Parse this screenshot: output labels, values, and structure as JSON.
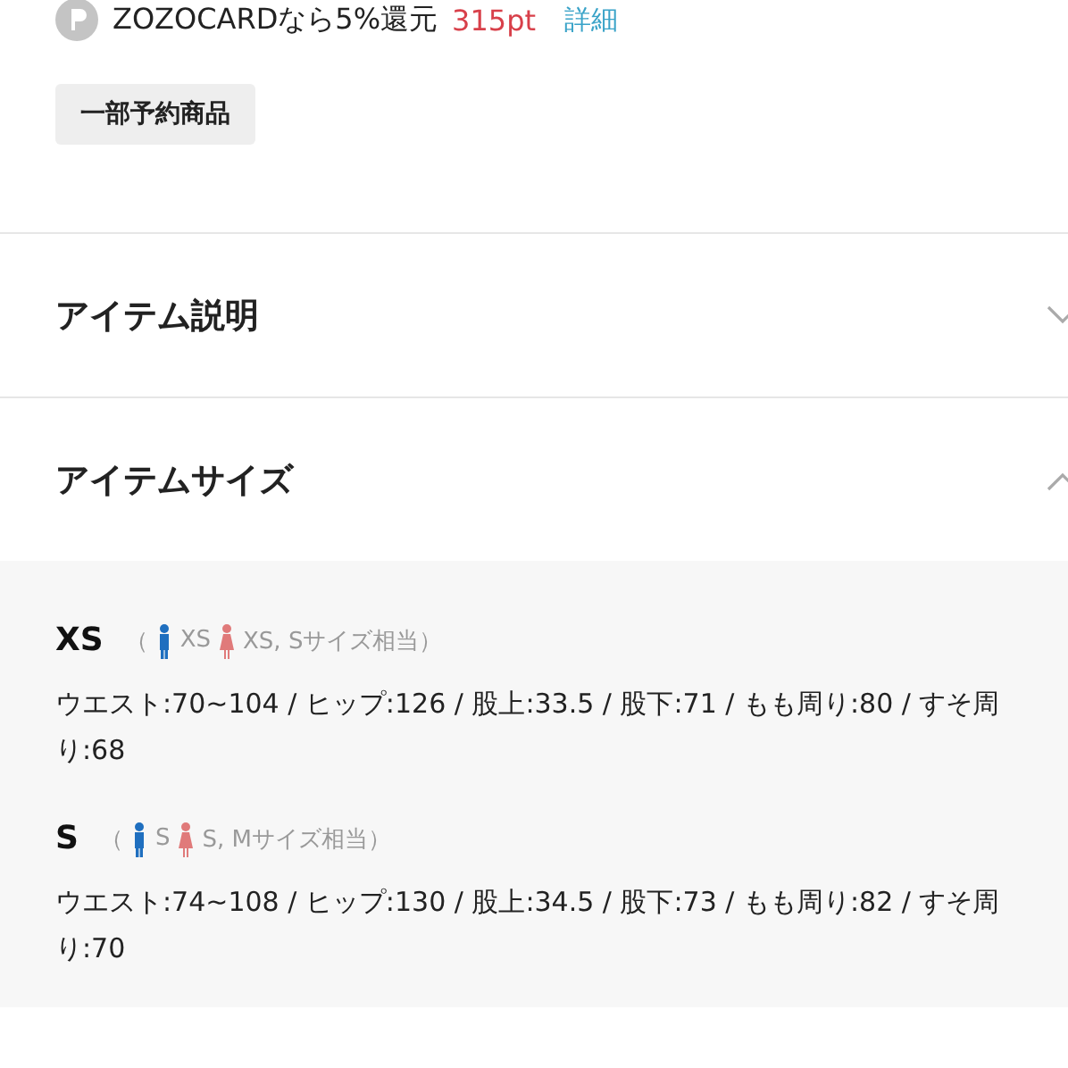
{
  "points": {
    "text": "ZOZOCARDなら5%還元",
    "points": "315pt",
    "link": "詳細"
  },
  "tag": "一部予約商品",
  "sections": [
    {
      "title": "アイテム説明",
      "expanded": false
    },
    {
      "title": "アイテムサイズ",
      "expanded": true
    }
  ],
  "sizes": [
    {
      "name": "XS",
      "open": "（",
      "men": "XS",
      "women": "XS, Sサイズ相当）",
      "detail": "ウエスト:70~104 / ヒップ:126 / 股上:33.5 / 股下:71 / もも周り:80 / すそ周り:68"
    },
    {
      "name": "S",
      "open": "（",
      "men": "S",
      "women": "S, Mサイズ相当）",
      "detail": "ウエスト:74~108 / ヒップ:130 / 股上:34.5 / 股下:73 / もも周り:82 / すそ周り:70"
    }
  ]
}
